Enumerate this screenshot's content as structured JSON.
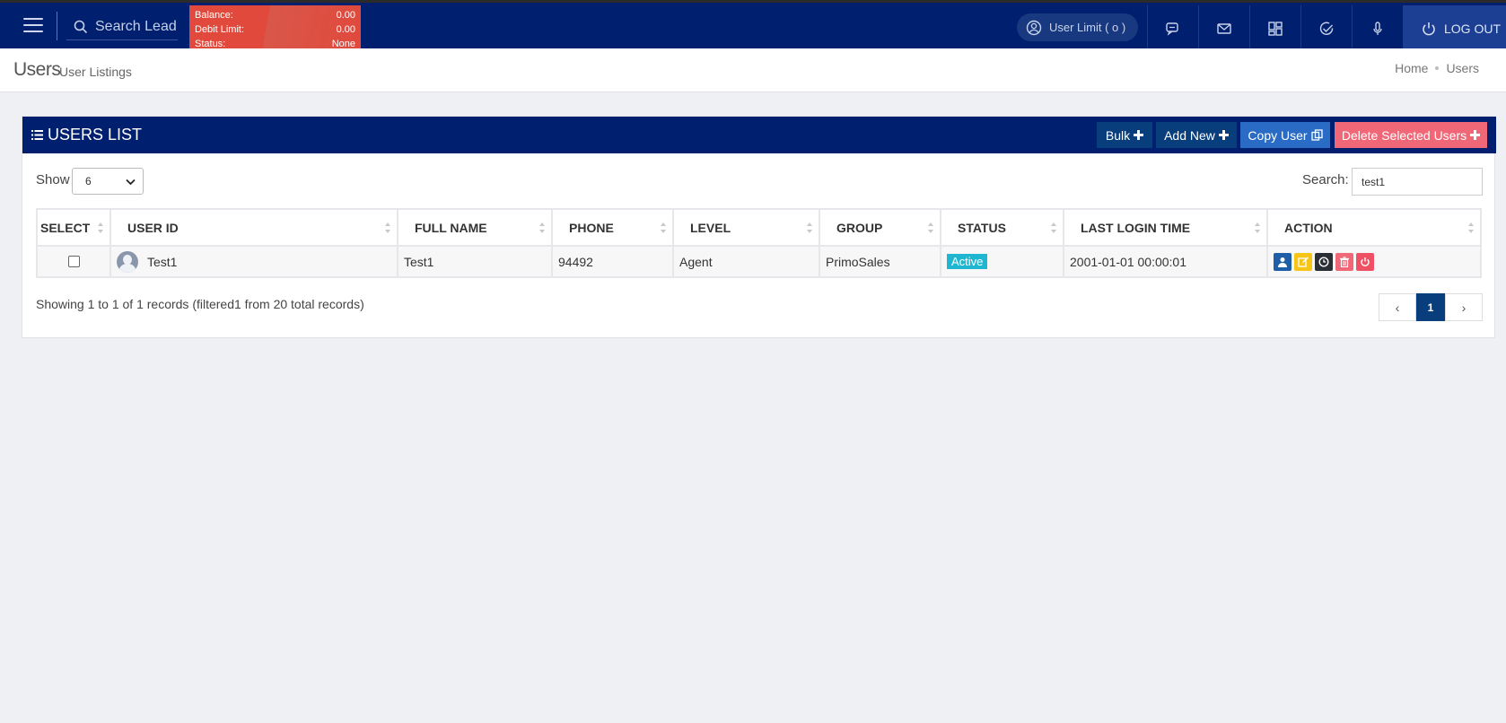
{
  "topbar": {
    "search_placeholder": "Search Lead",
    "balance": {
      "balance_label": "Balance:",
      "balance_value": "0.00",
      "debit_label": "Debit Limit:",
      "debit_value": "0.00",
      "status_label": "Status:",
      "status_value": "None"
    },
    "user_limit": "User Limit ( o )",
    "icons": [
      "chat-icon",
      "mail-icon",
      "dashboard-icon",
      "check-icon",
      "microphone-icon"
    ],
    "logout_label": "LOG OUT"
  },
  "page": {
    "title": "Users",
    "subtitle": "User Listings",
    "breadcrumb": [
      "Home",
      "Users"
    ]
  },
  "card": {
    "title": "USERS LIST",
    "buttons": {
      "bulk": "Bulk",
      "add_new": "Add New",
      "copy_user": "Copy User",
      "delete_selected": "Delete Selected Users"
    },
    "show_label": "Show",
    "show_value": "6",
    "search_label": "Search:",
    "search_value": "test1"
  },
  "table": {
    "columns": [
      "SELECT",
      "USER ID",
      "FULL NAME",
      "PHONE",
      "LEVEL",
      "GROUP",
      "STATUS",
      "LAST LOGIN TIME",
      "ACTION"
    ],
    "rows": [
      {
        "user_id": "Test1",
        "full_name": "Test1",
        "phone": "94492",
        "level": "Agent",
        "group": "PrimoSales",
        "status": "Active",
        "last_login": "2001-01-01 00:00:01"
      }
    ]
  },
  "footer": {
    "records_text": "Showing 1 to 1 of 1 records (filtered1 from 20 total records)",
    "pager": {
      "prev": "‹",
      "current": "1",
      "next": "›"
    }
  },
  "colors": {
    "navy": "#00206f",
    "balance_red": "#e0493c",
    "bulk_btn": "#083e7b",
    "copy_btn": "#2a6cc5",
    "delete_btn": "#f06878",
    "active_badge": "#1fb6d1"
  }
}
